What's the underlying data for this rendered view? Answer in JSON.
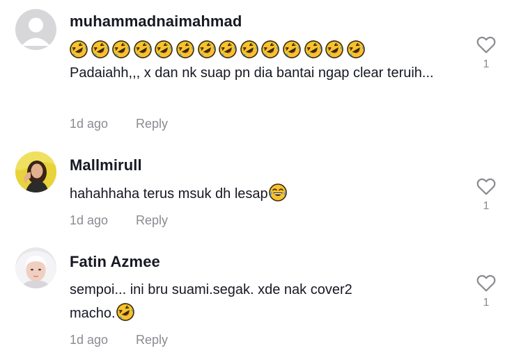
{
  "comments": [
    {
      "username": "muhammadnaimahmad",
      "emoji_count": 14,
      "emoji_icon": "rolling-on-floor-laughing-emoji",
      "text": "Padaiahh,,, x dan nk suap pn dia bantai ngap clear teruih...",
      "date": "1d ago",
      "reply_label": "Reply",
      "likes": "1"
    },
    {
      "username": "Mallmirull",
      "text": "hahahhaha terus msuk dh lesap",
      "trailing_emoji": "tears-of-joy-emoji",
      "date": "1d ago",
      "reply_label": "Reply",
      "likes": "1"
    },
    {
      "username": "Fatin Azmee",
      "text_line1": "sempoi... ini bru suami.segak. xde nak cover2",
      "text_line2": "macho.",
      "trailing_emoji": "rolling-on-floor-laughing-emoji",
      "date": "1d ago",
      "reply_label": "Reply",
      "likes": "1"
    }
  ],
  "colors": {
    "text": "#161823",
    "meta": "#8a8b91",
    "emoji_yellow": "#f7c22d",
    "emoji_outline": "#3a2a0c"
  }
}
